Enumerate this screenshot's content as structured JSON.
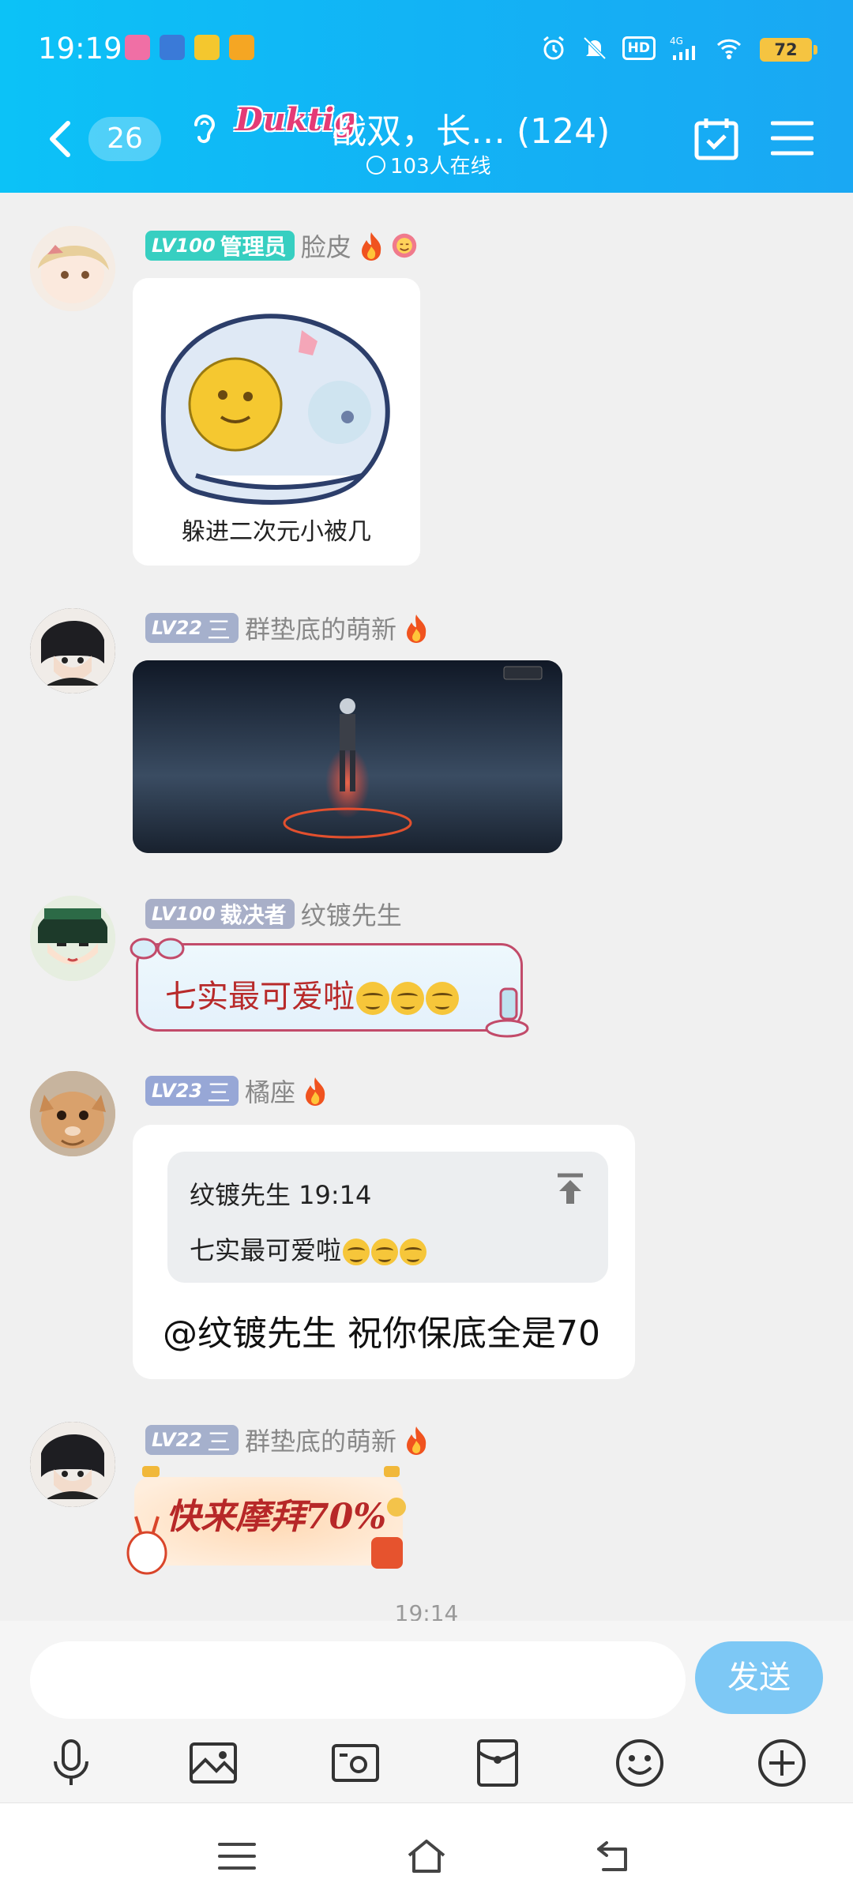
{
  "status_bar": {
    "time": "19:19",
    "network": "4G",
    "hd": "HD",
    "battery": "72"
  },
  "header": {
    "back_count": "26",
    "logo": "Duktig",
    "title": "战双，长… (124)",
    "online": "103人在线"
  },
  "messages": [
    {
      "level": "LV100",
      "role": "管理员",
      "name": "脸皮",
      "sticker_caption": "躲进二次元小被几"
    },
    {
      "level": "LV22",
      "role": "三",
      "name": "群垫底的萌新"
    },
    {
      "level": "LV100",
      "role": "裁决者",
      "name": "纹镀先生",
      "text": "七实最可爱啦"
    },
    {
      "level": "LV23",
      "role": "三",
      "name": "橘座",
      "quote_author": "纹镀先生 19:14",
      "quote_text": "七实最可爱啦",
      "reply": "@纹镀先生 祝你保底全是70"
    },
    {
      "level": "LV22",
      "role": "三",
      "name": "群垫底的萌新",
      "sticker_text": "快来摩拜70%"
    }
  ],
  "timestamp": "19:14",
  "input": {
    "placeholder": "",
    "send_label": "发送"
  },
  "colors": {
    "header_start": "#0cc2f7",
    "header_end": "#1aa8f3",
    "send_button": "#7dc8f5",
    "admin_badge": "#37cfc1",
    "judge_badge": "#a8afc8"
  }
}
